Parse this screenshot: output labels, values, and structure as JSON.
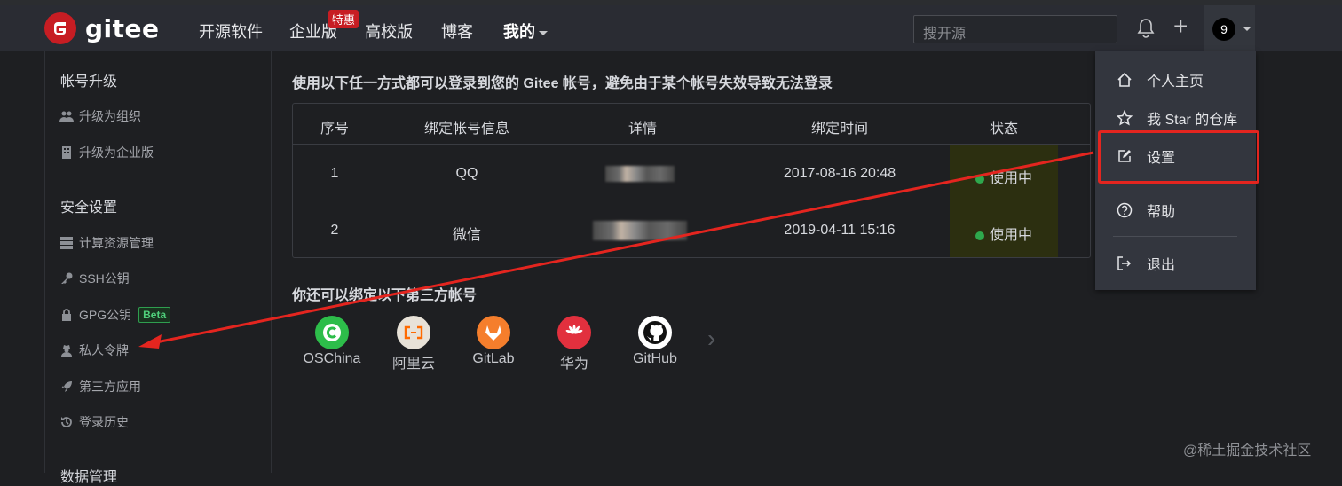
{
  "navbar": {
    "logo_text": "gitee",
    "links": [
      "开源软件",
      "企业版",
      "高校版",
      "博客",
      "我的"
    ],
    "promo_badge": "特惠",
    "search_placeholder": "搜开源",
    "avatar_initial": "9"
  },
  "sidebar": {
    "sections": [
      {
        "title": "帐号升级",
        "items": [
          "升级为组织",
          "升级为企业版"
        ]
      },
      {
        "title": "安全设置",
        "items": [
          "计算资源管理",
          "SSH公钥",
          "GPG公钥",
          "私人令牌",
          "第三方应用",
          "登录历史"
        ]
      },
      {
        "title": "数据管理"
      }
    ],
    "beta_badge": "Beta"
  },
  "main": {
    "title": "使用以下任一方式都可以登录到您的 Gitee 帐号，避免由于某个帐号失效导致无法登录",
    "table": {
      "headers": [
        "序号",
        "绑定帐号信息",
        "详情",
        "绑定时间",
        "状态"
      ],
      "rows": [
        {
          "index": "1",
          "account": "QQ",
          "time": "2017-08-16 20:48",
          "status": "使用中"
        },
        {
          "index": "2",
          "account": "微信",
          "time": "2019-04-11 15:16",
          "status": "使用中"
        }
      ]
    },
    "bind_title": "你还可以绑定以下第三方帐号",
    "providers": [
      "OSChina",
      "阿里云",
      "GitLab",
      "华为",
      "GitHub"
    ]
  },
  "dropdown": {
    "items": [
      "个人主页",
      "我 Star 的仓库",
      "设置",
      "帮助",
      "退出"
    ]
  },
  "watermark": "@稀土掘金技术社区",
  "colors": {
    "brand_red": "#c71d23",
    "status_green": "#2ea84d",
    "annotation_red": "#e4251f"
  }
}
